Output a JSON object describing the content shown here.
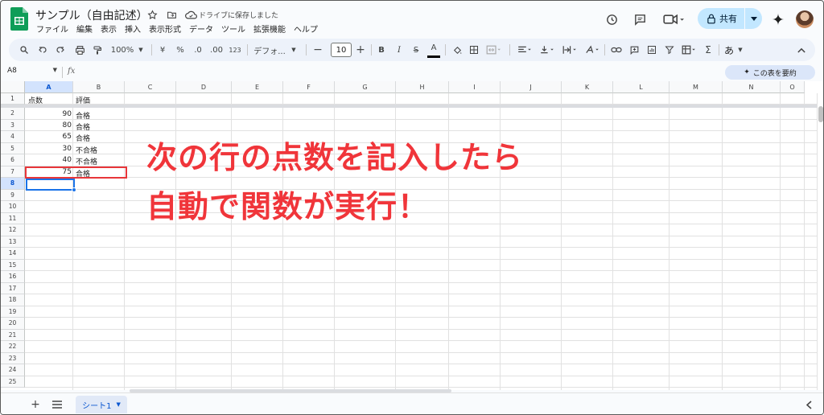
{
  "doc": {
    "title": "サンプル（自由記述）",
    "save_status": "ドライブに保存しました"
  },
  "menu": [
    "ファイル",
    "編集",
    "表示",
    "挿入",
    "表示形式",
    "データ",
    "ツール",
    "拡張機能",
    "ヘルプ"
  ],
  "share": {
    "label": "共有"
  },
  "toolbar": {
    "zoom": "100%",
    "currency": "¥",
    "percent": "%",
    "dec_decrease": ".0",
    "dec_increase": ".00",
    "number_format": "123",
    "font": "デフォ...",
    "font_size": "10",
    "bold": "B",
    "italic": "I",
    "strike": "S",
    "text_color": "A",
    "sum": "Σ",
    "input_mode": "あ"
  },
  "formula_bar": {
    "cell_ref": "A8",
    "fx": "fx",
    "summarize": "この表を要約"
  },
  "colors": {
    "accent": "#0b57d0",
    "annotation": "#f0353a",
    "share_bg": "#c2e7ff"
  },
  "grid": {
    "columns": [
      "A",
      "B",
      "C",
      "D",
      "E",
      "F",
      "G",
      "H",
      "I",
      "J",
      "K",
      "L",
      "M",
      "N",
      "O"
    ],
    "rows": [
      "1",
      "2",
      "3",
      "4",
      "5",
      "6",
      "7",
      "8",
      "9",
      "10",
      "11",
      "12",
      "13",
      "14",
      "15",
      "16",
      "17",
      "18",
      "19",
      "20",
      "21",
      "22",
      "23",
      "24",
      "25"
    ],
    "headers": [
      "点数",
      "評価"
    ],
    "data": [
      {
        "score": "90",
        "grade": "合格"
      },
      {
        "score": "80",
        "grade": "合格"
      },
      {
        "score": "65",
        "grade": "合格"
      },
      {
        "score": "30",
        "grade": "不合格"
      },
      {
        "score": "40",
        "grade": "不合格"
      },
      {
        "score": "75",
        "grade": "合格"
      }
    ],
    "selected_cell": "A8"
  },
  "annotation": {
    "line1": "次の行の点数を記入したら",
    "line2": "自動で関数が実行！"
  },
  "sheets": {
    "active": "シート1"
  }
}
